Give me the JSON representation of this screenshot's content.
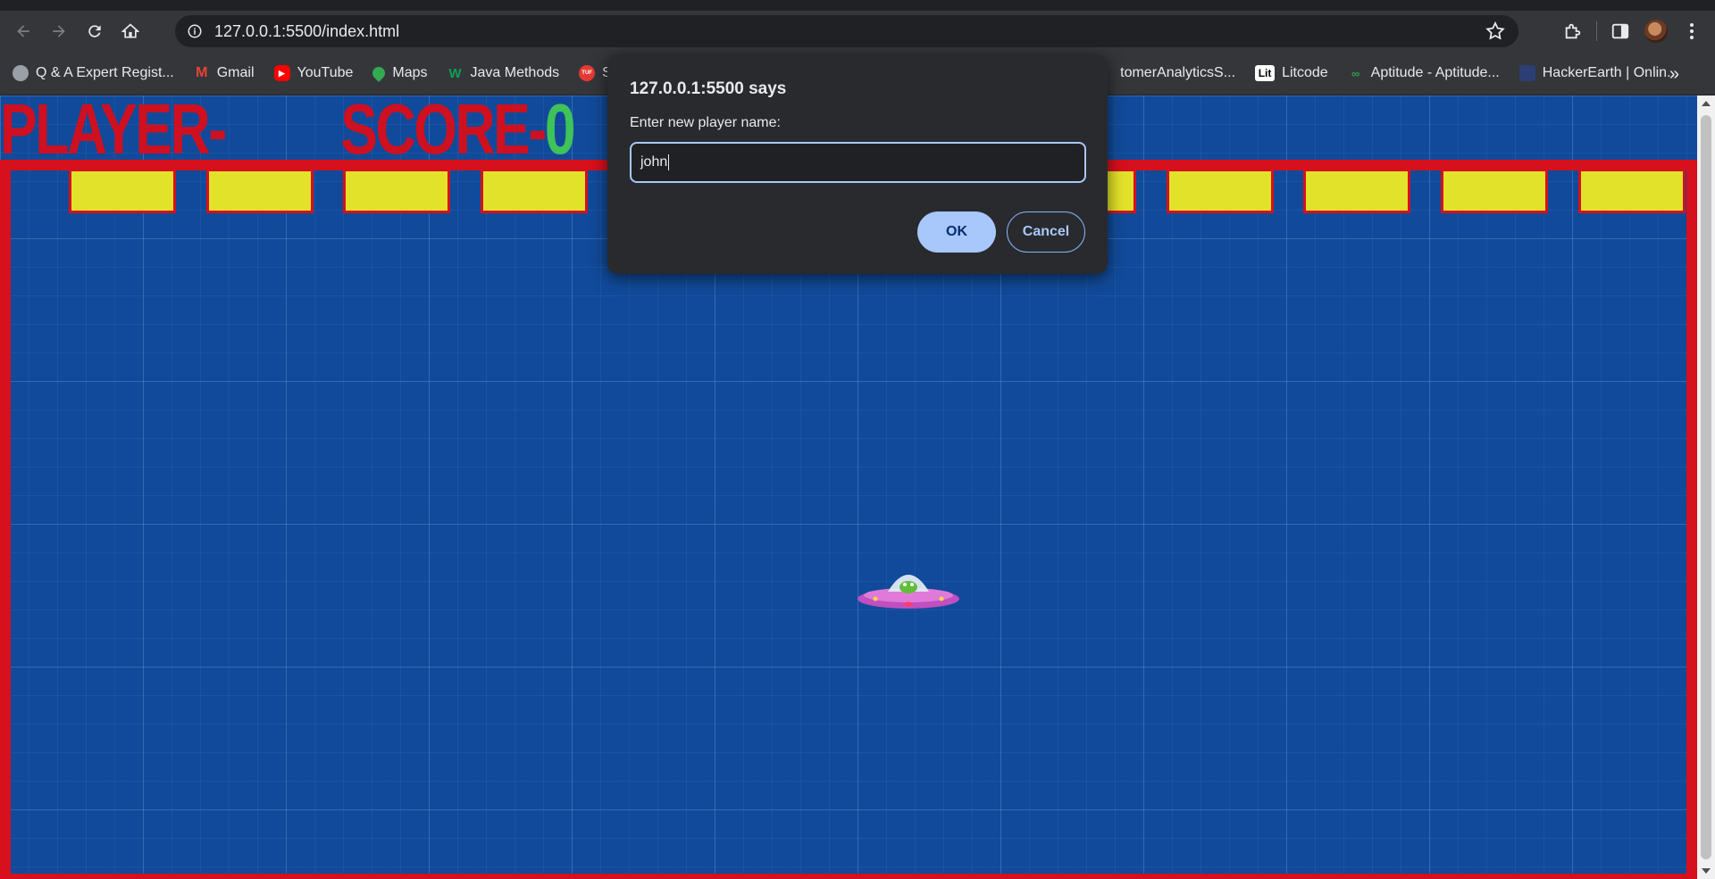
{
  "browser": {
    "url": "127.0.0.1:5500/index.html",
    "bookmarks": [
      {
        "label": "Q & A Expert Regist...",
        "icon": "globe-icon",
        "color": "#9aa0a6"
      },
      {
        "label": "Gmail",
        "icon": "gmail-icon",
        "color": "#ea4335"
      },
      {
        "label": "YouTube",
        "icon": "youtube-icon",
        "color": "#ff0000"
      },
      {
        "label": "Maps",
        "icon": "maps-icon",
        "color": "#34a853"
      },
      {
        "label": "Java Methods",
        "icon": "java-methods-icon",
        "color": "#0f9d58"
      },
      {
        "label": "Striv",
        "icon": "striver-icon",
        "color": "#e53935"
      },
      {
        "label": "tomerAnalyticsS...",
        "icon": "analytics-icon",
        "color": "#5f6368"
      },
      {
        "label": "Litcode",
        "icon": "litcode-icon",
        "color": "#ffffff"
      },
      {
        "label": "Aptitude - Aptitude...",
        "icon": "aptitude-icon",
        "color": "#2e7d32"
      },
      {
        "label": "HackerEarth | Onlin...",
        "icon": "hackerearth-icon",
        "color": "#2c3e75"
      }
    ]
  },
  "game": {
    "player_label": "PLAYER-",
    "player_name": "",
    "score_label": "SCORE-",
    "score_value": "0",
    "brick_count": 12,
    "colors": {
      "border": "#d6101c",
      "brick": "#e2e22a",
      "background": "#114a9a",
      "score_value": "#3fc25a"
    }
  },
  "dialog": {
    "title": "127.0.0.1:5500 says",
    "message": "Enter new player name:",
    "input_value": "john",
    "ok_label": "OK",
    "cancel_label": "Cancel"
  }
}
